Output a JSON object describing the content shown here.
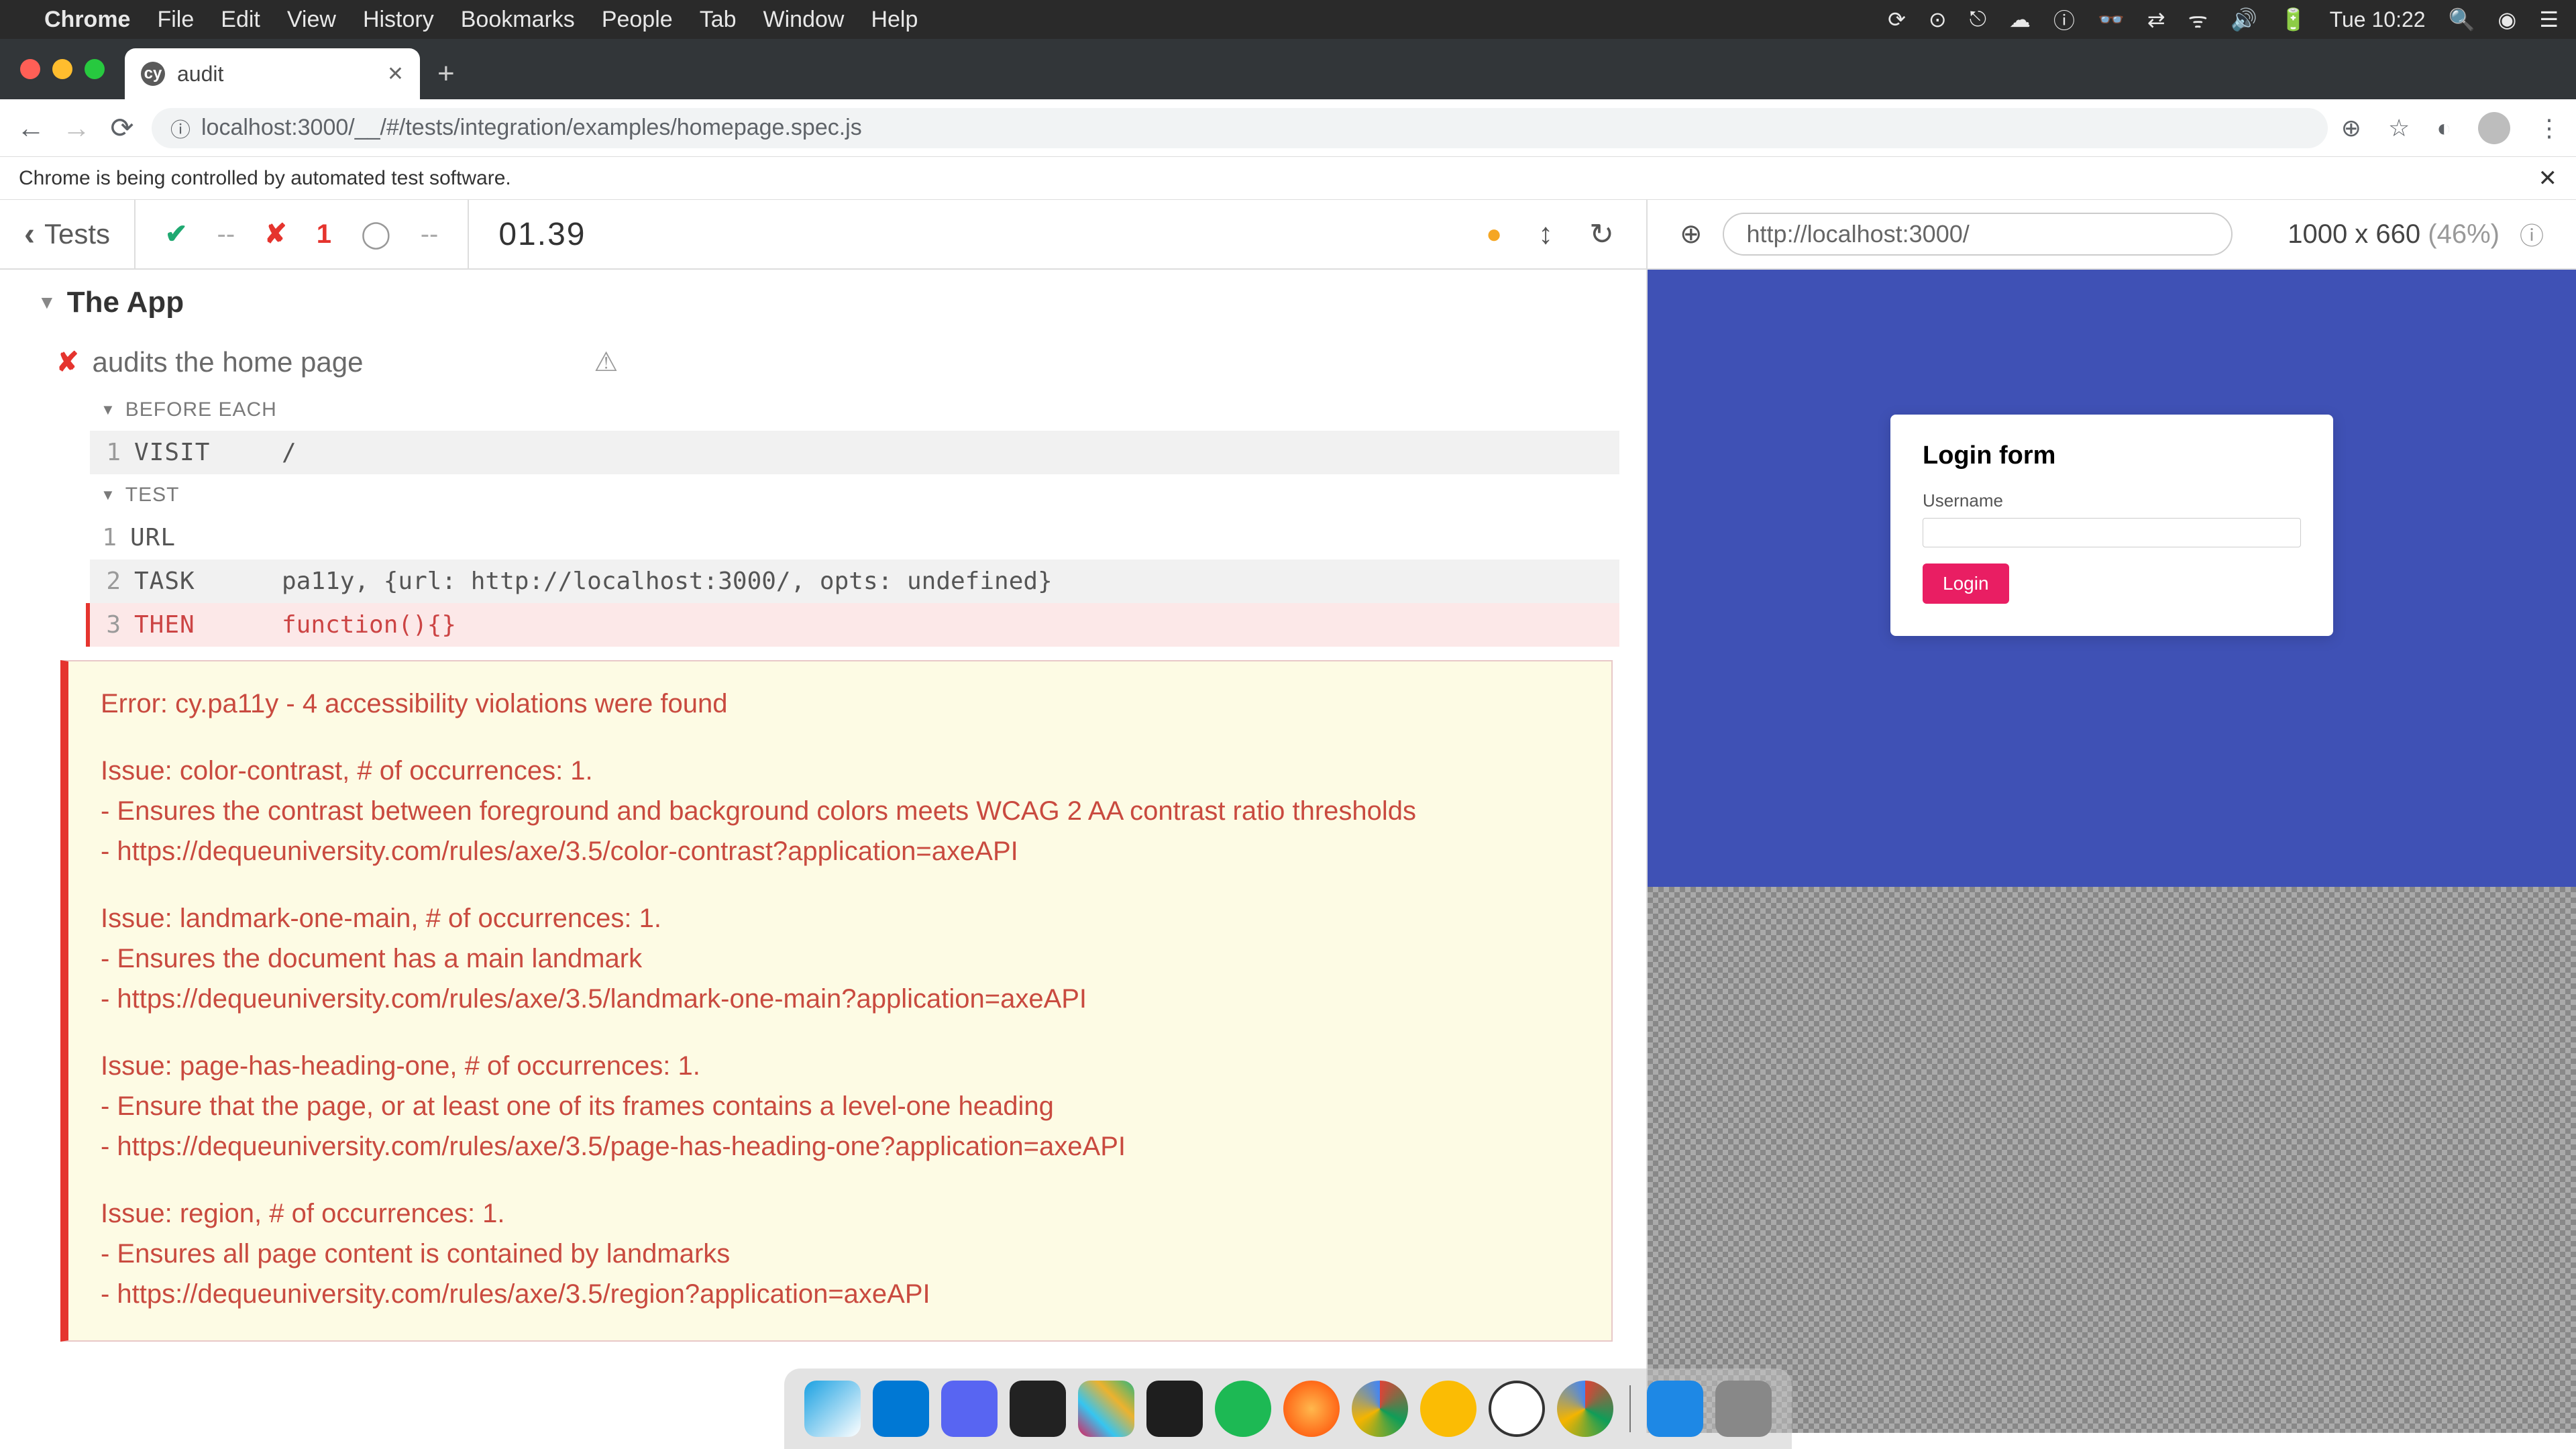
{
  "menubar": {
    "app": "Chrome",
    "items": [
      "File",
      "Edit",
      "View",
      "History",
      "Bookmarks",
      "People",
      "Tab",
      "Window",
      "Help"
    ],
    "clock": "Tue 10:22"
  },
  "tab": {
    "title": "audit"
  },
  "url": "localhost:3000/__/#/tests/integration/examples/homepage.spec.js",
  "notice": "Chrome is being controlled by automated test software.",
  "stats": {
    "tests_label": "Tests",
    "passed": "--",
    "failed": "1",
    "pending": "--",
    "duration": "01.39"
  },
  "suite": "The App",
  "test_name": "audits the home page",
  "hook_before": "BEFORE EACH",
  "hook_test": "TEST",
  "commands": {
    "c1": {
      "num": "1",
      "name": "VISIT",
      "args": "/"
    },
    "c2": {
      "num": "1",
      "name": "URL",
      "args": ""
    },
    "c3": {
      "num": "2",
      "name": "TASK",
      "args": "pa11y, {url: http://localhost:3000/, opts: undefined}"
    },
    "c4": {
      "num": "3",
      "name": "THEN",
      "args": "function(){}"
    }
  },
  "error": {
    "header": "Error: cy.pa11y - 4 accessibility violations were found",
    "issues": [
      {
        "title": "Issue: color-contrast, # of occurrences: 1.",
        "desc": "- Ensures the contrast between foreground and background colors meets WCAG 2 AA contrast ratio thresholds",
        "link": "- https://dequeuniversity.com/rules/axe/3.5/color-contrast?application=axeAPI"
      },
      {
        "title": "Issue: landmark-one-main, # of occurrences: 1.",
        "desc": "- Ensures the document has a main landmark",
        "link": "- https://dequeuniversity.com/rules/axe/3.5/landmark-one-main?application=axeAPI"
      },
      {
        "title": "Issue: page-has-heading-one, # of occurrences: 1.",
        "desc": "- Ensure that the page, or at least one of its frames contains a level-one heading",
        "link": "- https://dequeuniversity.com/rules/axe/3.5/page-has-heading-one?application=axeAPI"
      },
      {
        "title": "Issue: region, # of occurrences: 1.",
        "desc": "- Ensures all page content is contained by landmarks",
        "link": "- https://dequeuniversity.com/rules/axe/3.5/region?application=axeAPI"
      }
    ]
  },
  "preview": {
    "url": "http://localhost:3000/",
    "dims": "1000 x 660",
    "pct": "(46%)"
  },
  "login": {
    "title": "Login form",
    "username_label": "Username",
    "button": "Login"
  }
}
